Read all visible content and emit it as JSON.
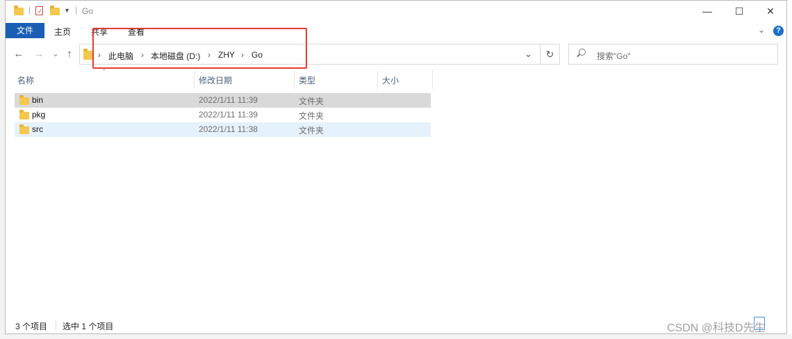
{
  "titlebar": {
    "title": "Go",
    "minimize": "—",
    "maximize": "☐",
    "close": "✕"
  },
  "ribbon": {
    "file_tab": "文件",
    "tabs": [
      "主页",
      "共享",
      "查看"
    ],
    "expand_icon": "chevron-down-icon",
    "help": "?"
  },
  "nav": {
    "back": "←",
    "forward": "→",
    "recent": "⌄",
    "up": "↑"
  },
  "address": {
    "crumbs": [
      "此电脑",
      "本地磁盘 (D:)",
      "ZHY",
      "Go"
    ],
    "separator": "›",
    "dropdown": "⌄",
    "refresh": "↻"
  },
  "search": {
    "placeholder": "搜索\"Go\""
  },
  "columns": [
    "名称",
    "修改日期",
    "类型",
    "大小"
  ],
  "files": [
    {
      "name": "bin",
      "date": "2022/1/11 11:39",
      "type": "文件夹",
      "state": "selected"
    },
    {
      "name": "pkg",
      "date": "2022/1/11 11:39",
      "type": "文件夹",
      "state": "normal"
    },
    {
      "name": "src",
      "date": "2022/1/11 11:38",
      "type": "文件夹",
      "state": "hover"
    }
  ],
  "status": {
    "count": "3 个项目",
    "selection": "选中 1 个项目"
  },
  "watermark": "CSDN @科技D先生",
  "colors": {
    "accent": "#1a5fb4",
    "selected_row": "#d9d9d9",
    "hover_row": "#e5f1fb",
    "highlight_box": "#e53935",
    "folder": "#f4c84e"
  }
}
